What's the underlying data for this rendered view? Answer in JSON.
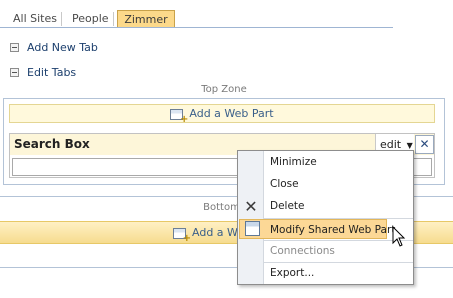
{
  "tabs": [
    {
      "label": "All Sites",
      "active": false
    },
    {
      "label": "People",
      "active": false
    },
    {
      "label": "Zimmer",
      "active": true
    }
  ],
  "links": {
    "add_new_tab": "Add New Tab",
    "edit_tabs": "Edit Tabs"
  },
  "zones": {
    "top_label": "Top Zone",
    "bottom_label": "Bottom Z",
    "add_web_part": "Add a Web Part",
    "bottom_add_web_part": "Add a W"
  },
  "web_part": {
    "title": "Search Box",
    "edit_label": "edit",
    "close_label": "✕"
  },
  "menu": {
    "items": [
      {
        "label": "Minimize",
        "disabled": false
      },
      {
        "label": "Close",
        "disabled": false
      },
      {
        "label": "Delete",
        "disabled": false
      },
      {
        "label": "Modify Shared Web Part",
        "disabled": false,
        "highlighted": true
      },
      {
        "label": "Connections",
        "disabled": true
      },
      {
        "label": "Export...",
        "disabled": false
      }
    ]
  },
  "colors": {
    "active_tab": "#fcd98a",
    "menu_highlight": "#fcd896",
    "link": "#1c3f6d"
  },
  "icons": {
    "delete": "close-icon",
    "modify": "web-part-edit-icon",
    "add": "add-web-part-icon",
    "pointer": "mouse-cursor-icon"
  }
}
